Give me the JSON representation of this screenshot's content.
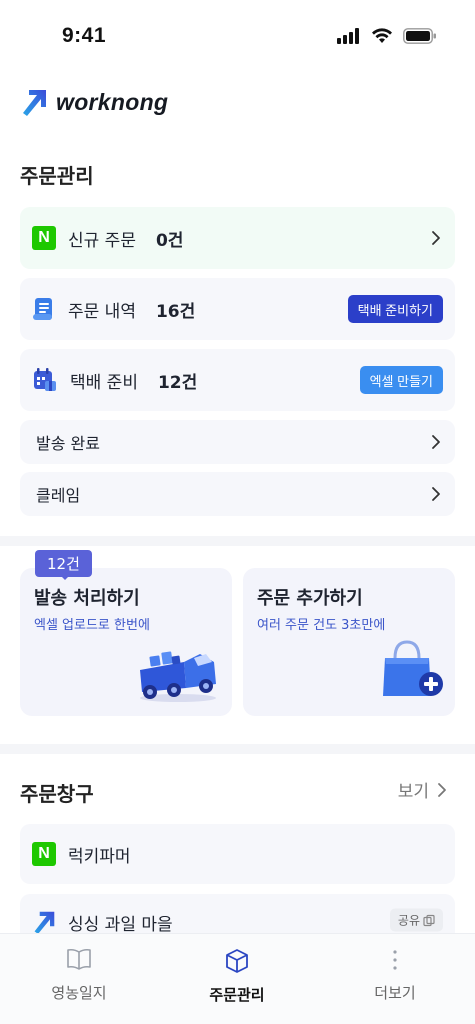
{
  "status_bar": {
    "time": "9:41"
  },
  "app": {
    "logo_text": "worknong"
  },
  "order_management": {
    "title": "주문관리",
    "rows": [
      {
        "label": "신규 주문",
        "count": "0건",
        "icon": "naver-n-icon"
      },
      {
        "label": "주문 내역",
        "count": "16건",
        "button": "택배 준비하기",
        "icon": "document-icon"
      },
      {
        "label": "택배 준비",
        "count": "12건",
        "button": "엑셀 만들기",
        "icon": "calendar-box-icon"
      },
      {
        "label": "발송 완료"
      },
      {
        "label": "클레임"
      }
    ]
  },
  "cards": [
    {
      "badge": "12건",
      "title": "발송 처리하기",
      "subtitle": "엑셀 업로드로 한번에",
      "icon": "delivery-truck-icon"
    },
    {
      "title": "주문 추가하기",
      "subtitle": "여러 주문 건도 3초만에",
      "icon": "shopping-bag-plus-icon"
    }
  ],
  "order_channels": {
    "title": "주문창구",
    "more_label": "보기",
    "items": [
      {
        "label": "럭키파머",
        "icon": "naver-n-icon"
      },
      {
        "label": "싱싱 과일 마을",
        "icon": "worknong-logo-icon",
        "action": "공유"
      }
    ]
  },
  "bottom_nav": {
    "items": [
      {
        "label": "영농일지",
        "icon": "book-icon",
        "active": false
      },
      {
        "label": "주문관리",
        "icon": "box-icon",
        "active": true
      },
      {
        "label": "더보기",
        "icon": "more-dots-icon",
        "active": false
      }
    ]
  },
  "colors": {
    "accent_dark": "#2b3fc9",
    "accent_light": "#3a8ef0",
    "badge": "#5a62d8",
    "naver_green": "#1ec800"
  }
}
